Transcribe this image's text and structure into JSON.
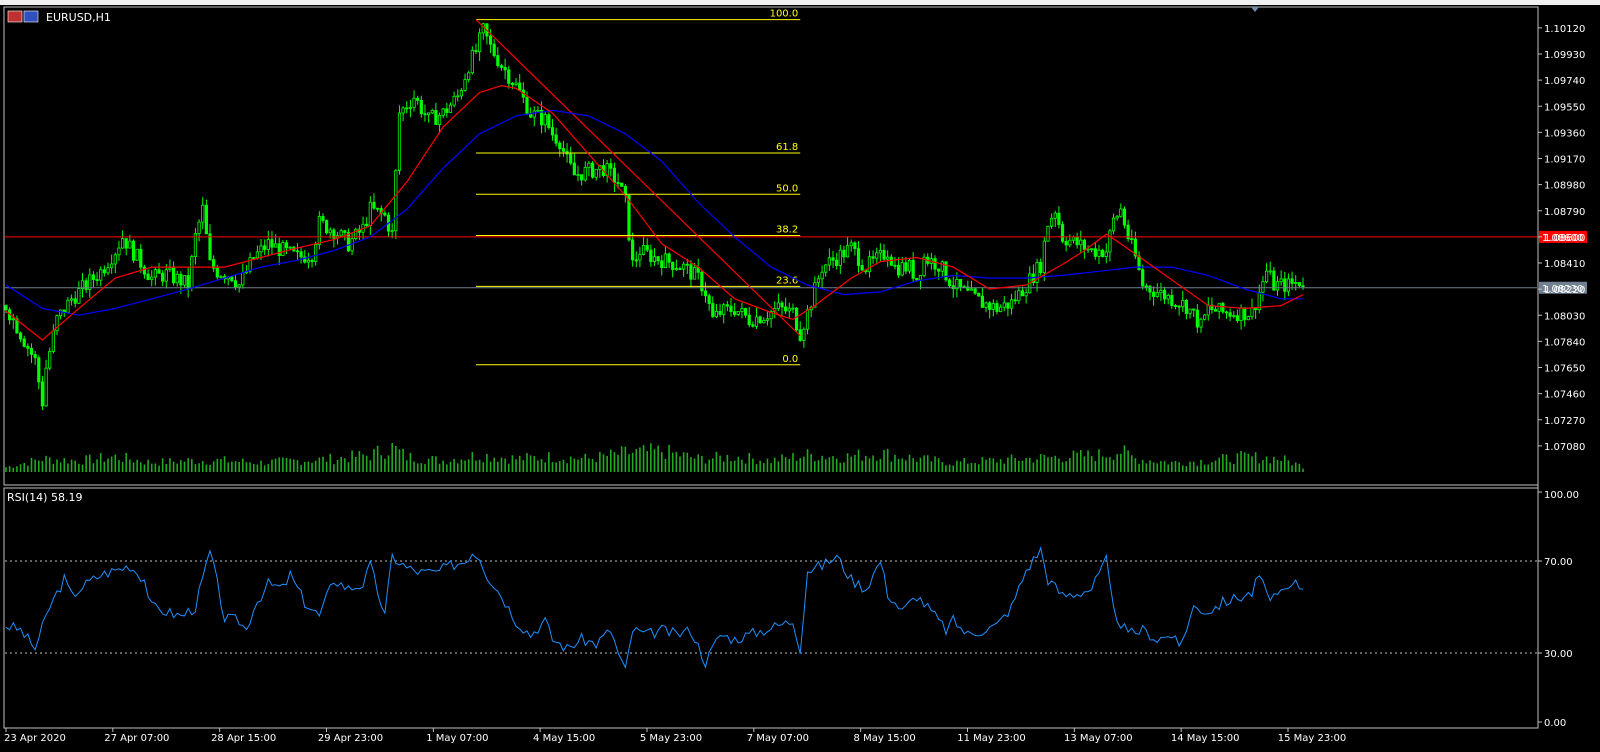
{
  "window": {
    "symbol_title": "EURUSD,H1"
  },
  "rsi_panel": {
    "label": "RSI(14) 58.19"
  },
  "colors": {
    "background": "#000000",
    "frame": "#c0c0c0",
    "candle": "#00ff00",
    "volume": "#22aa22",
    "ma_fast": "#ff0000",
    "ma_slow": "#0000ff",
    "fib": "#ffff00",
    "trendline": "#ff0000",
    "hline": "#ff0000",
    "rsi": "#1e90ff",
    "axis_text": "#ffffff"
  },
  "chart_data": [
    {
      "type": "candlestick",
      "title": "EURUSD,H1",
      "ylim": [
        1.0689,
        1.1025
      ],
      "y_ticks": [
        "1.10120",
        "1.09930",
        "1.09740",
        "1.09550",
        "1.09360",
        "1.09170",
        "1.08980",
        "1.08790",
        "1.08600",
        "1.08410",
        "1.08220",
        "1.08030",
        "1.07840",
        "1.07650",
        "1.07460",
        "1.07270",
        "1.07080"
      ],
      "x_ticks": [
        "23 Apr 2020",
        "27 Apr 07:00",
        "28 Apr 15:00",
        "29 Apr 23:00",
        "1 May 07:00",
        "4 May 15:00",
        "5 May 23:00",
        "7 May 07:00",
        "8 May 15:00",
        "11 May 23:00",
        "13 May 07:00",
        "14 May 15:00",
        "15 May 23:00"
      ],
      "price_path": [
        [
          0,
          1.081
        ],
        [
          2,
          1.08
        ],
        [
          5,
          1.0785
        ],
        [
          8,
          1.077
        ],
        [
          10,
          1.074
        ],
        [
          11,
          1.0765
        ],
        [
          14,
          1.08
        ],
        [
          18,
          1.0815
        ],
        [
          22,
          1.0825
        ],
        [
          26,
          1.0835
        ],
        [
          30,
          1.085
        ],
        [
          32,
          1.086
        ],
        [
          36,
          1.0845
        ],
        [
          40,
          1.083
        ],
        [
          44,
          1.0833
        ],
        [
          48,
          1.0828
        ],
        [
          50,
          1.0825
        ],
        [
          52,
          1.086
        ],
        [
          54,
          1.088
        ],
        [
          56,
          1.084
        ],
        [
          58,
          1.0835
        ],
        [
          62,
          1.0832
        ],
        [
          64,
          1.0825
        ],
        [
          68,
          1.0845
        ],
        [
          72,
          1.0855
        ],
        [
          76,
          1.085
        ],
        [
          80,
          1.0845
        ],
        [
          84,
          1.0848
        ],
        [
          86,
          1.087
        ],
        [
          90,
          1.0865
        ],
        [
          94,
          1.0855
        ],
        [
          98,
          1.0866
        ],
        [
          100,
          1.088
        ],
        [
          104,
          1.0875
        ],
        [
          106,
          1.0862
        ],
        [
          108,
          1.095
        ],
        [
          112,
          1.0962
        ],
        [
          116,
          1.0945
        ],
        [
          120,
          1.095
        ],
        [
          124,
          1.0962
        ],
        [
          127,
          1.0985
        ],
        [
          129,
          1.0995
        ],
        [
          131,
          1.101
        ],
        [
          133,
          1.0998
        ],
        [
          136,
          1.0985
        ],
        [
          140,
          1.097
        ],
        [
          144,
          1.095
        ],
        [
          148,
          1.0945
        ],
        [
          150,
          1.0935
        ],
        [
          152,
          1.093
        ],
        [
          154,
          1.0915
        ],
        [
          156,
          1.0905
        ],
        [
          160,
          1.0908
        ],
        [
          164,
          1.091
        ],
        [
          168,
          1.09
        ],
        [
          170,
          1.0885
        ],
        [
          172,
          1.084
        ],
        [
          174,
          1.085
        ],
        [
          178,
          1.0845
        ],
        [
          182,
          1.0842
        ],
        [
          186,
          1.0838
        ],
        [
          190,
          1.083
        ],
        [
          192,
          1.082
        ],
        [
          194,
          1.08
        ],
        [
          196,
          1.0805
        ],
        [
          200,
          1.0808
        ],
        [
          204,
          1.08
        ],
        [
          208,
          1.0803
        ],
        [
          212,
          1.0808
        ],
        [
          216,
          1.0805
        ],
        [
          218,
          1.079
        ],
        [
          220,
          1.0805
        ],
        [
          224,
          1.0838
        ],
        [
          228,
          1.0845
        ],
        [
          232,
          1.0852
        ],
        [
          236,
          1.0838
        ],
        [
          240,
          1.0845
        ],
        [
          242,
          1.085
        ],
        [
          244,
          1.0838
        ],
        [
          248,
          1.0838
        ],
        [
          250,
          1.083
        ],
        [
          252,
          1.0845
        ],
        [
          256,
          1.084
        ],
        [
          260,
          1.0825
        ],
        [
          264,
          1.0818
        ],
        [
          268,
          1.0812
        ],
        [
          272,
          1.0808
        ],
        [
          276,
          1.0812
        ],
        [
          280,
          1.0825
        ],
        [
          284,
          1.084
        ],
        [
          286,
          1.087
        ],
        [
          288,
          1.088
        ],
        [
          290,
          1.086
        ],
        [
          294,
          1.0855
        ],
        [
          298,
          1.085
        ],
        [
          302,
          1.085
        ],
        [
          304,
          1.0872
        ],
        [
          306,
          1.088
        ],
        [
          308,
          1.086
        ],
        [
          310,
          1.0845
        ],
        [
          312,
          1.0825
        ],
        [
          316,
          1.082
        ],
        [
          320,
          1.0815
        ],
        [
          324,
          1.081
        ],
        [
          326,
          1.0803
        ],
        [
          328,
          1.0795
        ],
        [
          330,
          1.0808
        ],
        [
          334,
          1.0805
        ],
        [
          338,
          1.0805
        ],
        [
          342,
          1.0805
        ],
        [
          344,
          1.082
        ],
        [
          346,
          1.0835
        ],
        [
          348,
          1.0825
        ],
        [
          352,
          1.0825
        ],
        [
          356,
          1.0828
        ]
      ],
      "ma_fast_path": [
        [
          0,
          1.0806
        ],
        [
          10,
          1.0785
        ],
        [
          20,
          1.0808
        ],
        [
          30,
          1.083
        ],
        [
          40,
          1.0838
        ],
        [
          50,
          1.0838
        ],
        [
          60,
          1.0838
        ],
        [
          70,
          1.0845
        ],
        [
          80,
          1.0852
        ],
        [
          90,
          1.0858
        ],
        [
          100,
          1.0868
        ],
        [
          110,
          1.09
        ],
        [
          120,
          1.094
        ],
        [
          130,
          1.0965
        ],
        [
          136,
          1.097
        ],
        [
          140,
          1.0968
        ],
        [
          150,
          1.095
        ],
        [
          160,
          1.092
        ],
        [
          170,
          1.089
        ],
        [
          180,
          1.0855
        ],
        [
          190,
          1.0838
        ],
        [
          200,
          1.0815
        ],
        [
          210,
          1.0805
        ],
        [
          216,
          1.08
        ],
        [
          222,
          1.081
        ],
        [
          232,
          1.083
        ],
        [
          240,
          1.0842
        ],
        [
          250,
          1.0845
        ],
        [
          260,
          1.0838
        ],
        [
          270,
          1.0822
        ],
        [
          280,
          1.0825
        ],
        [
          290,
          1.084
        ],
        [
          296,
          1.085
        ],
        [
          302,
          1.0862
        ],
        [
          306,
          1.0855
        ],
        [
          314,
          1.084
        ],
        [
          322,
          1.0825
        ],
        [
          330,
          1.081
        ],
        [
          340,
          1.0808
        ],
        [
          350,
          1.081
        ],
        [
          356,
          1.0818
        ]
      ],
      "ma_slow_path": [
        [
          0,
          1.0825
        ],
        [
          10,
          1.0808
        ],
        [
          20,
          1.0803
        ],
        [
          30,
          1.0808
        ],
        [
          40,
          1.0815
        ],
        [
          50,
          1.0822
        ],
        [
          60,
          1.083
        ],
        [
          70,
          1.0838
        ],
        [
          80,
          1.0843
        ],
        [
          90,
          1.085
        ],
        [
          100,
          1.086
        ],
        [
          110,
          1.088
        ],
        [
          120,
          1.091
        ],
        [
          130,
          1.0935
        ],
        [
          140,
          1.0948
        ],
        [
          150,
          1.0952
        ],
        [
          160,
          1.0948
        ],
        [
          170,
          1.0935
        ],
        [
          180,
          1.0915
        ],
        [
          190,
          1.0885
        ],
        [
          200,
          1.086
        ],
        [
          210,
          1.0838
        ],
        [
          220,
          1.0825
        ],
        [
          230,
          1.0818
        ],
        [
          240,
          1.082
        ],
        [
          250,
          1.0828
        ],
        [
          260,
          1.0832
        ],
        [
          270,
          1.083
        ],
        [
          280,
          1.083
        ],
        [
          290,
          1.0832
        ],
        [
          300,
          1.0835
        ],
        [
          310,
          1.0838
        ],
        [
          320,
          1.0838
        ],
        [
          330,
          1.0832
        ],
        [
          340,
          1.0822
        ],
        [
          350,
          1.0815
        ],
        [
          356,
          1.0815
        ]
      ],
      "volume_path": [
        [
          0,
          5
        ],
        [
          10,
          14
        ],
        [
          20,
          12
        ],
        [
          30,
          16
        ],
        [
          40,
          10
        ],
        [
          50,
          12
        ],
        [
          60,
          12
        ],
        [
          70,
          10
        ],
        [
          80,
          12
        ],
        [
          90,
          14
        ],
        [
          100,
          18
        ],
        [
          106,
          26
        ],
        [
          110,
          16
        ],
        [
          120,
          12
        ],
        [
          130,
          18
        ],
        [
          140,
          14
        ],
        [
          150,
          16
        ],
        [
          160,
          14
        ],
        [
          170,
          20
        ],
        [
          180,
          22
        ],
        [
          190,
          14
        ],
        [
          200,
          16
        ],
        [
          210,
          12
        ],
        [
          220,
          18
        ],
        [
          230,
          16
        ],
        [
          240,
          20
        ],
        [
          250,
          14
        ],
        [
          260,
          10
        ],
        [
          270,
          12
        ],
        [
          280,
          14
        ],
        [
          290,
          16
        ],
        [
          300,
          18
        ],
        [
          306,
          22
        ],
        [
          310,
          14
        ],
        [
          320,
          10
        ],
        [
          330,
          12
        ],
        [
          340,
          16
        ],
        [
          350,
          14
        ],
        [
          356,
          6
        ]
      ],
      "fibonacci": {
        "levels": [
          {
            "label": "100.0",
            "price": 1.1018
          },
          {
            "label": "61.8",
            "price": 1.0921
          },
          {
            "label": "50.0",
            "price": 1.0891
          },
          {
            "label": "38.2",
            "price": 1.0861
          },
          {
            "label": "23.6",
            "price": 1.0824
          },
          {
            "label": "0.0",
            "price": 1.0767
          }
        ],
        "x_start": 129,
        "x_end": 218,
        "trend_start": [
          129,
          1.1018
        ],
        "trend_end": [
          218,
          1.0788
        ]
      },
      "horizontal_line": {
        "price": 1.086,
        "label": "1.08600"
      },
      "current_price": {
        "price": 1.0823,
        "label": "1.08230"
      }
    },
    {
      "type": "line",
      "title": "RSI(14) 58.19",
      "ylim": [
        0,
        100
      ],
      "y_ticks": [
        "100.00",
        "70.00",
        "30.00",
        "0.00"
      ],
      "levels": [
        70,
        30
      ],
      "values": [
        [
          0,
          42
        ],
        [
          4,
          40
        ],
        [
          8,
          32
        ],
        [
          12,
          50
        ],
        [
          16,
          62
        ],
        [
          18,
          55
        ],
        [
          22,
          60
        ],
        [
          26,
          64
        ],
        [
          30,
          66
        ],
        [
          34,
          68
        ],
        [
          38,
          62
        ],
        [
          40,
          50
        ],
        [
          44,
          48
        ],
        [
          48,
          46
        ],
        [
          52,
          50
        ],
        [
          56,
          74
        ],
        [
          58,
          60
        ],
        [
          60,
          45
        ],
        [
          64,
          44
        ],
        [
          66,
          40
        ],
        [
          68,
          50
        ],
        [
          72,
          60
        ],
        [
          76,
          58
        ],
        [
          78,
          64
        ],
        [
          82,
          52
        ],
        [
          86,
          46
        ],
        [
          90,
          62
        ],
        [
          94,
          58
        ],
        [
          98,
          60
        ],
        [
          100,
          68
        ],
        [
          104,
          46
        ],
        [
          106,
          72
        ],
        [
          110,
          67
        ],
        [
          114,
          65
        ],
        [
          118,
          65
        ],
        [
          122,
          68
        ],
        [
          126,
          70
        ],
        [
          128,
          74
        ],
        [
          130,
          72
        ],
        [
          132,
          64
        ],
        [
          136,
          55
        ],
        [
          140,
          44
        ],
        [
          144,
          38
        ],
        [
          148,
          44
        ],
        [
          150,
          36
        ],
        [
          154,
          32
        ],
        [
          158,
          36
        ],
        [
          162,
          34
        ],
        [
          166,
          40
        ],
        [
          168,
          30
        ],
        [
          170,
          22
        ],
        [
          172,
          40
        ],
        [
          176,
          38
        ],
        [
          180,
          40
        ],
        [
          184,
          38
        ],
        [
          188,
          40
        ],
        [
          192,
          26
        ],
        [
          196,
          38
        ],
        [
          200,
          36
        ],
        [
          204,
          38
        ],
        [
          208,
          40
        ],
        [
          212,
          42
        ],
        [
          216,
          44
        ],
        [
          218,
          32
        ],
        [
          220,
          66
        ],
        [
          224,
          68
        ],
        [
          228,
          72
        ],
        [
          232,
          62
        ],
        [
          236,
          58
        ],
        [
          240,
          70
        ],
        [
          242,
          56
        ],
        [
          246,
          48
        ],
        [
          250,
          55
        ],
        [
          254,
          48
        ],
        [
          258,
          40
        ],
        [
          260,
          44
        ],
        [
          264,
          38
        ],
        [
          268,
          40
        ],
        [
          272,
          42
        ],
        [
          276,
          50
        ],
        [
          280,
          66
        ],
        [
          284,
          75
        ],
        [
          286,
          62
        ],
        [
          290,
          55
        ],
        [
          294,
          56
        ],
        [
          298,
          58
        ],
        [
          302,
          70
        ],
        [
          304,
          48
        ],
        [
          308,
          38
        ],
        [
          312,
          40
        ],
        [
          316,
          36
        ],
        [
          320,
          38
        ],
        [
          322,
          32
        ],
        [
          326,
          50
        ],
        [
          330,
          48
        ],
        [
          334,
          52
        ],
        [
          338,
          54
        ],
        [
          342,
          56
        ],
        [
          344,
          64
        ],
        [
          346,
          55
        ],
        [
          350,
          55
        ],
        [
          354,
          60
        ],
        [
          356,
          58
        ]
      ]
    }
  ]
}
